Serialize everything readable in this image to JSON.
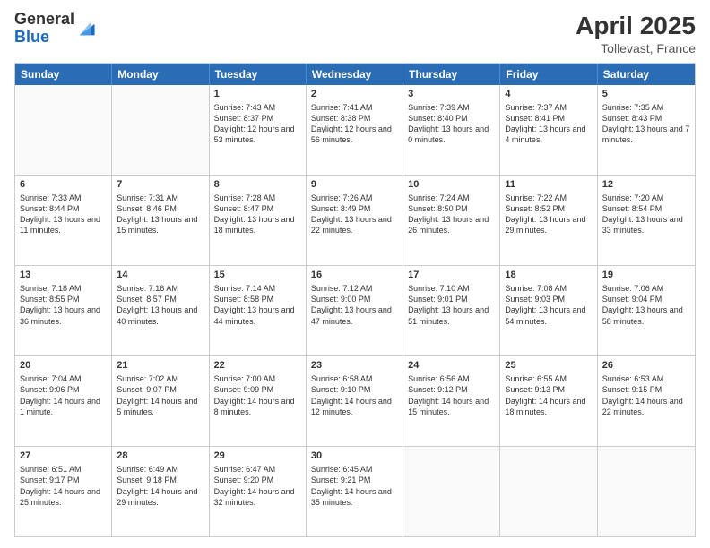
{
  "header": {
    "logo_general": "General",
    "logo_blue": "Blue",
    "month_year": "April 2025",
    "location": "Tollevast, France"
  },
  "weekdays": [
    "Sunday",
    "Monday",
    "Tuesday",
    "Wednesday",
    "Thursday",
    "Friday",
    "Saturday"
  ],
  "rows": [
    [
      {
        "day": "",
        "text": ""
      },
      {
        "day": "",
        "text": ""
      },
      {
        "day": "1",
        "text": "Sunrise: 7:43 AM\nSunset: 8:37 PM\nDaylight: 12 hours and 53 minutes."
      },
      {
        "day": "2",
        "text": "Sunrise: 7:41 AM\nSunset: 8:38 PM\nDaylight: 12 hours and 56 minutes."
      },
      {
        "day": "3",
        "text": "Sunrise: 7:39 AM\nSunset: 8:40 PM\nDaylight: 13 hours and 0 minutes."
      },
      {
        "day": "4",
        "text": "Sunrise: 7:37 AM\nSunset: 8:41 PM\nDaylight: 13 hours and 4 minutes."
      },
      {
        "day": "5",
        "text": "Sunrise: 7:35 AM\nSunset: 8:43 PM\nDaylight: 13 hours and 7 minutes."
      }
    ],
    [
      {
        "day": "6",
        "text": "Sunrise: 7:33 AM\nSunset: 8:44 PM\nDaylight: 13 hours and 11 minutes."
      },
      {
        "day": "7",
        "text": "Sunrise: 7:31 AM\nSunset: 8:46 PM\nDaylight: 13 hours and 15 minutes."
      },
      {
        "day": "8",
        "text": "Sunrise: 7:28 AM\nSunset: 8:47 PM\nDaylight: 13 hours and 18 minutes."
      },
      {
        "day": "9",
        "text": "Sunrise: 7:26 AM\nSunset: 8:49 PM\nDaylight: 13 hours and 22 minutes."
      },
      {
        "day": "10",
        "text": "Sunrise: 7:24 AM\nSunset: 8:50 PM\nDaylight: 13 hours and 26 minutes."
      },
      {
        "day": "11",
        "text": "Sunrise: 7:22 AM\nSunset: 8:52 PM\nDaylight: 13 hours and 29 minutes."
      },
      {
        "day": "12",
        "text": "Sunrise: 7:20 AM\nSunset: 8:54 PM\nDaylight: 13 hours and 33 minutes."
      }
    ],
    [
      {
        "day": "13",
        "text": "Sunrise: 7:18 AM\nSunset: 8:55 PM\nDaylight: 13 hours and 36 minutes."
      },
      {
        "day": "14",
        "text": "Sunrise: 7:16 AM\nSunset: 8:57 PM\nDaylight: 13 hours and 40 minutes."
      },
      {
        "day": "15",
        "text": "Sunrise: 7:14 AM\nSunset: 8:58 PM\nDaylight: 13 hours and 44 minutes."
      },
      {
        "day": "16",
        "text": "Sunrise: 7:12 AM\nSunset: 9:00 PM\nDaylight: 13 hours and 47 minutes."
      },
      {
        "day": "17",
        "text": "Sunrise: 7:10 AM\nSunset: 9:01 PM\nDaylight: 13 hours and 51 minutes."
      },
      {
        "day": "18",
        "text": "Sunrise: 7:08 AM\nSunset: 9:03 PM\nDaylight: 13 hours and 54 minutes."
      },
      {
        "day": "19",
        "text": "Sunrise: 7:06 AM\nSunset: 9:04 PM\nDaylight: 13 hours and 58 minutes."
      }
    ],
    [
      {
        "day": "20",
        "text": "Sunrise: 7:04 AM\nSunset: 9:06 PM\nDaylight: 14 hours and 1 minute."
      },
      {
        "day": "21",
        "text": "Sunrise: 7:02 AM\nSunset: 9:07 PM\nDaylight: 14 hours and 5 minutes."
      },
      {
        "day": "22",
        "text": "Sunrise: 7:00 AM\nSunset: 9:09 PM\nDaylight: 14 hours and 8 minutes."
      },
      {
        "day": "23",
        "text": "Sunrise: 6:58 AM\nSunset: 9:10 PM\nDaylight: 14 hours and 12 minutes."
      },
      {
        "day": "24",
        "text": "Sunrise: 6:56 AM\nSunset: 9:12 PM\nDaylight: 14 hours and 15 minutes."
      },
      {
        "day": "25",
        "text": "Sunrise: 6:55 AM\nSunset: 9:13 PM\nDaylight: 14 hours and 18 minutes."
      },
      {
        "day": "26",
        "text": "Sunrise: 6:53 AM\nSunset: 9:15 PM\nDaylight: 14 hours and 22 minutes."
      }
    ],
    [
      {
        "day": "27",
        "text": "Sunrise: 6:51 AM\nSunset: 9:17 PM\nDaylight: 14 hours and 25 minutes."
      },
      {
        "day": "28",
        "text": "Sunrise: 6:49 AM\nSunset: 9:18 PM\nDaylight: 14 hours and 29 minutes."
      },
      {
        "day": "29",
        "text": "Sunrise: 6:47 AM\nSunset: 9:20 PM\nDaylight: 14 hours and 32 minutes."
      },
      {
        "day": "30",
        "text": "Sunrise: 6:45 AM\nSunset: 9:21 PM\nDaylight: 14 hours and 35 minutes."
      },
      {
        "day": "",
        "text": ""
      },
      {
        "day": "",
        "text": ""
      },
      {
        "day": "",
        "text": ""
      }
    ]
  ]
}
